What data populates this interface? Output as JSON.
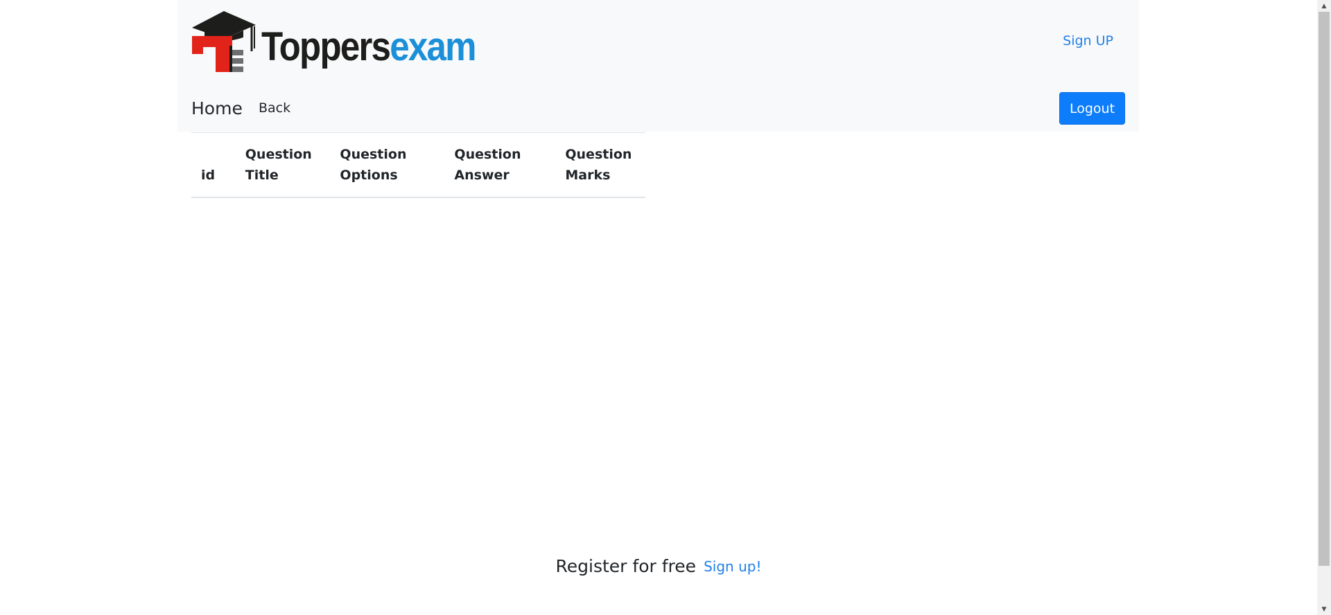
{
  "brand": {
    "logo_name_part1": "Toppers",
    "logo_name_part2": "exam",
    "colors": {
      "red": "#e2231a",
      "dark": "#1d1d1b",
      "blue": "#1b8fd8",
      "grey": "#6d6e70"
    }
  },
  "header": {
    "signup_label": "Sign UP"
  },
  "nav": {
    "home_label": "Home",
    "back_label": "Back",
    "logout_label": "Logout"
  },
  "table": {
    "columns": [
      {
        "line1": "",
        "line2": "id"
      },
      {
        "line1": "Question",
        "line2": "Title"
      },
      {
        "line1": "Question",
        "line2": "Options"
      },
      {
        "line1": "Question",
        "line2": "Answer"
      },
      {
        "line1": "Question",
        "line2": "Marks"
      }
    ],
    "rows": []
  },
  "footer": {
    "text": "Register for free",
    "link_label": "Sign up!"
  },
  "theme": {
    "accent": "#0d7dfc",
    "link": "#1f80e8",
    "header_bg": "#f8f9fa"
  }
}
